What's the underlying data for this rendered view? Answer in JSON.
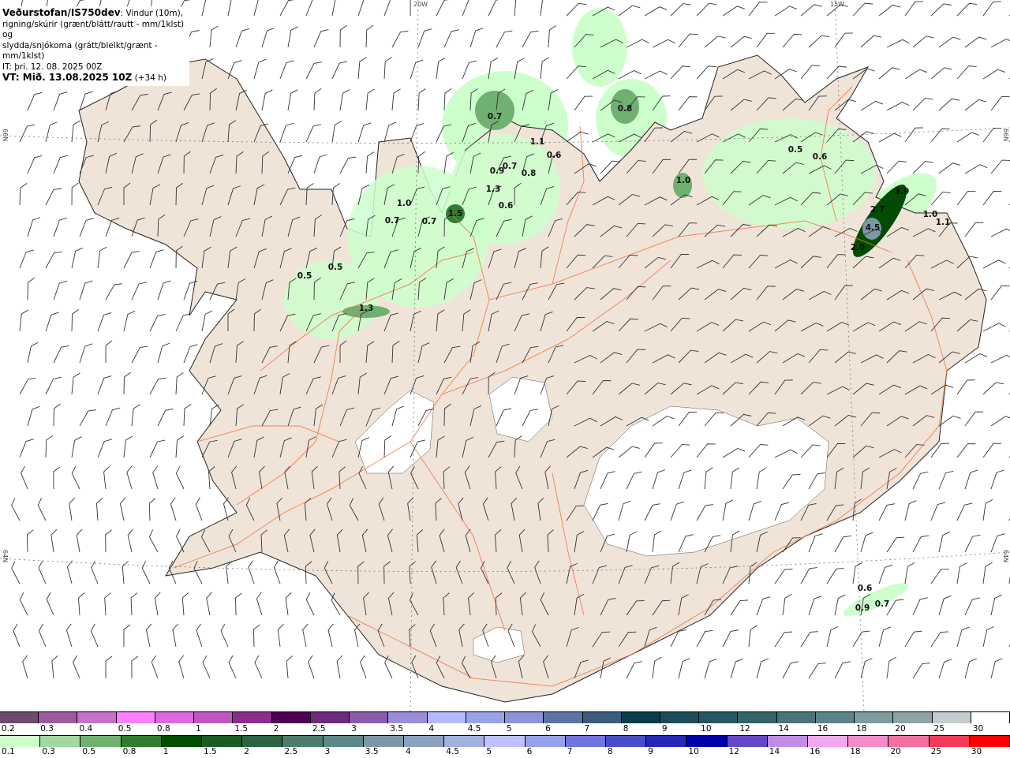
{
  "header": {
    "source": "Veðurstofan/IS750dev",
    "description_1": ": Vindur (10m),",
    "description_2": "rigning/skúrir (grænt/blátt/rautt - mm/1klst) og",
    "description_3": "slydda/snjókoma (grátt/bleikt/grænt - mm/1klst)",
    "issue_time": "IT: þri. 12. 08. 2025 00Z",
    "valid_time": "VT: Mið. 13.08.2025 10Z",
    "lead": " (+34 h)"
  },
  "axes": {
    "lon_20w": "20W",
    "lon_15w": "15W",
    "lat_66n": "66N",
    "lat_64n": "64N"
  },
  "precip_labels": [
    "0.7",
    "0.8",
    "1.1",
    "0.6",
    "0.9",
    "0.7",
    "0.8",
    "1.3",
    "0.6",
    "1.0",
    "0.7",
    "0.7",
    "1.5",
    "0.5",
    "0.5",
    "1.3",
    "1.0",
    "0.5",
    "0.6",
    "3.9",
    "2.7",
    "4.5",
    "2.0",
    "1.0",
    "1.1",
    "0.6",
    "0.9",
    "0.7"
  ],
  "colorbar_snow": {
    "labels": [
      "0.2",
      "0.3",
      "0.4",
      "0.5",
      "0.8",
      "1",
      "1.5",
      "2",
      "2.5",
      "3",
      "3.5",
      "4",
      "4.5",
      "5",
      "6",
      "7",
      "8",
      "9",
      "10",
      "12",
      "14",
      "16",
      "18",
      "20",
      "25",
      "30"
    ],
    "colors": [
      "#6e4a6e",
      "#9c5c9c",
      "#c870c8",
      "#ff80ff",
      "#dc6adc",
      "#c056c0",
      "#8c2c8c",
      "#500050",
      "#6c2c7c",
      "#8c5cac",
      "#9c8cdc",
      "#b4b8ff",
      "#98a4e8",
      "#8c94d4",
      "#5c74a4",
      "#3c5c7c",
      "#0c3c4c",
      "#1c4c5c",
      "#245860",
      "#346468",
      "#4c7478",
      "#5c8488",
      "#7c9ca0",
      "#8ca4a8",
      "#c4ccd0",
      "#ffffff"
    ]
  },
  "colorbar_rain": {
    "labels": [
      "0.1",
      "0.3",
      "0.5",
      "0.8",
      "1",
      "1.5",
      "2",
      "2.5",
      "3",
      "3.5",
      "4",
      "4.5",
      "5",
      "6",
      "7",
      "8",
      "9",
      "10",
      "12",
      "14",
      "16",
      "18",
      "20",
      "25",
      "30"
    ],
    "colors": [
      "#ccffcc",
      "#a0d8a0",
      "#70b070",
      "#307c30",
      "#004c00",
      "#1c5c24",
      "#2c6444",
      "#4c7c6c",
      "#5c8888",
      "#7c98a4",
      "#8ca0c0",
      "#a4b0e0",
      "#c0c0ff",
      "#98a0ec",
      "#7074dc",
      "#4c4cc8",
      "#2828b8",
      "#0000a8",
      "#6448c8",
      "#c08ce8",
      "#f4a8ec",
      "#f48cc8",
      "#f470a0",
      "#f43c58",
      "#ff0000"
    ]
  },
  "colors": {
    "land": "#f0e4d8",
    "roads": "#f07040",
    "glacier": "#ffffff",
    "sea": "#ffffff"
  }
}
